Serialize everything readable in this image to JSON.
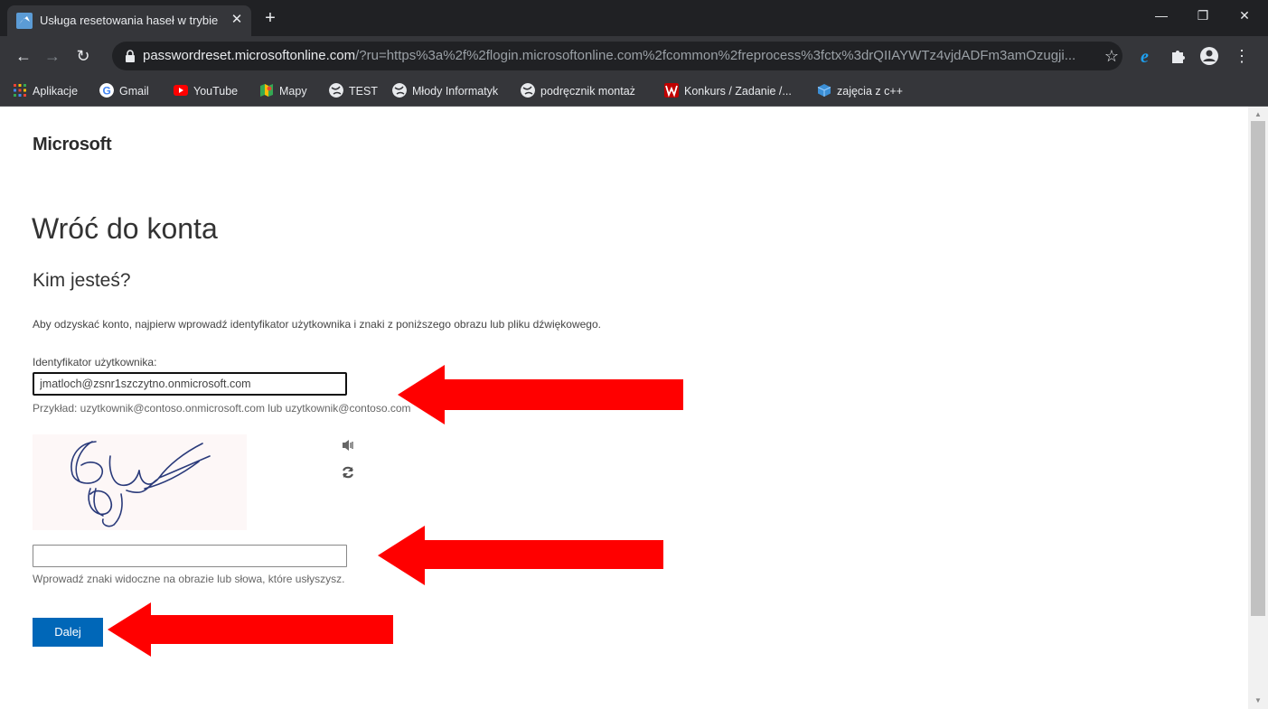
{
  "browser": {
    "tab_title": "Usługa resetowania haseł w trybie",
    "tab_close": "✕",
    "new_tab": "+",
    "url_host": "passwordreset.microsoftonline.com",
    "url_rest": "/?ru=https%3a%2f%2flogin.microsoftonline.com%2fcommon%2freprocess%3fctx%3drQIIAYWTz4vjdADFm3amOzugji...",
    "window_buttons": [
      "—",
      "❐",
      "✕"
    ],
    "bookmarks": [
      {
        "label": "Aplikacje",
        "icon": "apps-grid-icon",
        "color": "#f4b400"
      },
      {
        "label": "Gmail",
        "icon": "google-icon",
        "color": "#ffffff"
      },
      {
        "label": "YouTube",
        "icon": "youtube-icon",
        "color": "#ff0000"
      },
      {
        "label": "Mapy",
        "icon": "maps-icon",
        "color": "#34a853"
      },
      {
        "label": "TEST",
        "icon": "globe-icon",
        "color": "#e8eaed"
      },
      {
        "label": "Młody Informatyk",
        "icon": "globe-icon",
        "color": "#e8eaed"
      },
      {
        "label": "podręcznik montaż",
        "icon": "globe-icon",
        "color": "#e8eaed"
      },
      {
        "label": "Konkurs / Zadanie /...",
        "icon": "w-logo-icon",
        "color": "#c00000"
      },
      {
        "label": "zajęcia z c++",
        "icon": "box-icon",
        "color": "#3b8fd6"
      }
    ]
  },
  "page": {
    "brand": "Microsoft",
    "title": "Wróć do konta",
    "subtitle": "Kim jesteś?",
    "description": "Aby odzyskać konto, najpierw wprowadź identyfikator użytkownika i znaki z poniższego obrazu lub pliku dźwiękowego.",
    "user_id_label": "Identyfikator użytkownika:",
    "user_id_value": "jmatloch@zsnr1szczytno.onmicrosoft.com",
    "example": "Przykład: uzytkownik@contoso.onmicrosoft.com lub uzytkownik@contoso.com",
    "captcha_hint": "Wprowadź znaki widoczne na obrazie lub słowa, które usłyszysz.",
    "next_button": "Dalej",
    "accent_color": "#0067b8",
    "annotation_arrow_color": "#ff0000"
  }
}
